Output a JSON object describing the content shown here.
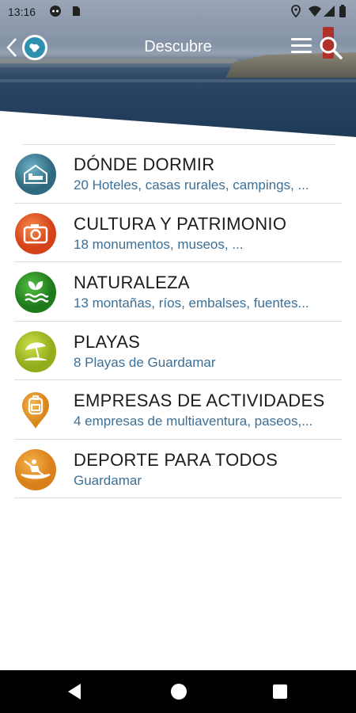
{
  "status_bar": {
    "time": "13:16",
    "left_icons": [
      "game-controller-icon",
      "sd-card-icon"
    ],
    "right_icons": [
      "location-icon",
      "wifi-icon",
      "signal-icon",
      "battery-icon"
    ]
  },
  "app_bar": {
    "title": "Descubre",
    "back_icon": "chevron-left-icon",
    "logo_icon": "globe-logo-icon",
    "menu_icon": "hamburger-menu-icon",
    "search_icon": "search-icon"
  },
  "colors": {
    "subtitle_text": "#3d6f95",
    "label_text": "#1c1c1c",
    "divider": "#dcdcdc"
  },
  "categories": [
    {
      "label": "DÓNDE DORMIR",
      "subtitle": "20 Hoteles, casas rurales, campings, ...",
      "icon": "hotel-bed-icon",
      "color": "#3f7f96"
    },
    {
      "label": "CULTURA Y PATRIMONIO",
      "subtitle": "18 monumentos, museos, ...",
      "icon": "camera-icon",
      "color": "#e2561e"
    },
    {
      "label": "NATURALEZA",
      "subtitle": "13  montañas, ríos, embalses, fuentes...",
      "icon": "leaf-water-icon",
      "color": "#3a9a2a"
    },
    {
      "label": "PLAYAS",
      "subtitle": "8 Playas de Guardamar",
      "icon": "beach-umbrella-icon",
      "color": "#a9c42a"
    },
    {
      "label": "EMPRESAS DE ACTIVIDADES",
      "subtitle": "4 empresas de multiaventura, paseos,...",
      "icon": "backpack-pin-icon",
      "color": "#e8a02c"
    },
    {
      "label": "DEPORTE PARA TODOS",
      "subtitle": "Guardamar",
      "icon": "kayak-icon",
      "color": "#e8961a"
    }
  ],
  "nav_bar": {
    "back_icon": "nav-back-icon",
    "home_icon": "nav-home-icon",
    "recent_icon": "nav-recents-icon"
  }
}
